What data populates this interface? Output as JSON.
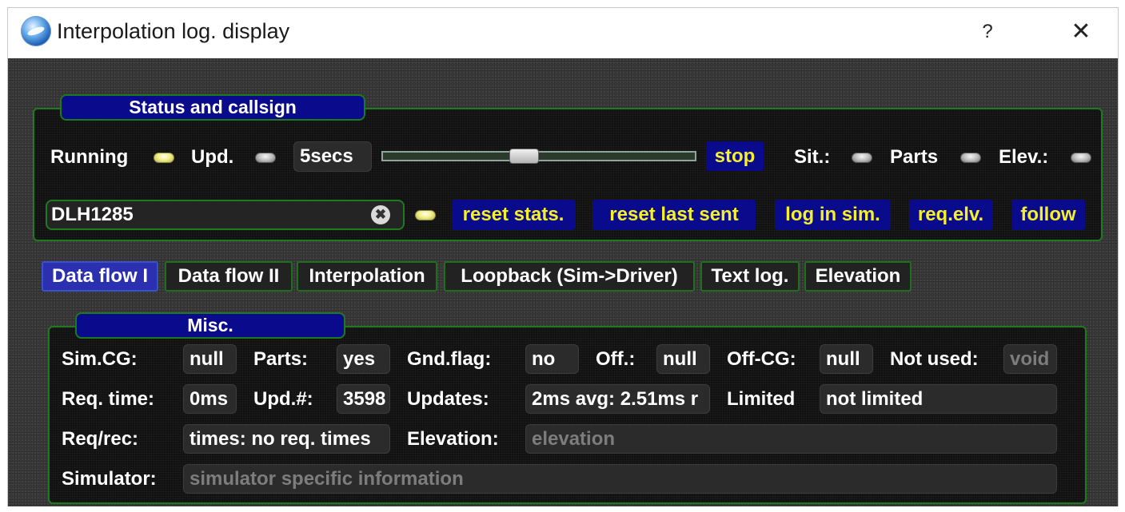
{
  "window": {
    "title": "Interpolation log. display",
    "help": "?",
    "close": "✕",
    "icon": "app-logo-icon"
  },
  "status": {
    "title": "Status and callsign",
    "running_label": "Running",
    "upd_label": "Upd.",
    "interval": "5secs",
    "stop_label": "stop",
    "sit_label": "Sit.:",
    "parts_label": "Parts",
    "elev_label": "Elev.:",
    "callsign": "DLH1285",
    "clear_glyph": "✖",
    "buttons": {
      "reset_stats": "reset stats.",
      "reset_last_sent": "reset last sent",
      "log_in_sim": "log in sim.",
      "req_elv": "req.elv.",
      "follow": "follow"
    }
  },
  "tabs": [
    {
      "label": "Data flow I",
      "active": true
    },
    {
      "label": "Data flow II"
    },
    {
      "label": "Interpolation"
    },
    {
      "label": "Loopback (Sim->Driver)"
    },
    {
      "label": "Text log."
    },
    {
      "label": "Elevation"
    }
  ],
  "misc": {
    "title": "Misc.",
    "simcg": {
      "label": "Sim.CG:",
      "value": "null"
    },
    "parts": {
      "label": "Parts:",
      "value": "yes"
    },
    "gndflag": {
      "label": "Gnd.flag:",
      "value": "no"
    },
    "off": {
      "label": "Off.:",
      "value": "null"
    },
    "offcg": {
      "label": "Off-CG:",
      "value": "null"
    },
    "notused": {
      "label": "Not used:",
      "value": "void"
    },
    "reqtime": {
      "label": "Req. time:",
      "value": "0ms"
    },
    "updnum": {
      "label": "Upd.#:",
      "value": "3598"
    },
    "updates": {
      "label": "Updates:",
      "value": "2ms avg: 2.51ms r"
    },
    "limited": {
      "label": "Limited",
      "value": "not limited"
    },
    "reqrec": {
      "label": "Req/rec:",
      "value": "times: no req. times"
    },
    "elevation": {
      "label": "Elevation:",
      "placeholder": "elevation"
    },
    "simulator": {
      "label": "Simulator:",
      "placeholder": "simulator specific information"
    }
  }
}
